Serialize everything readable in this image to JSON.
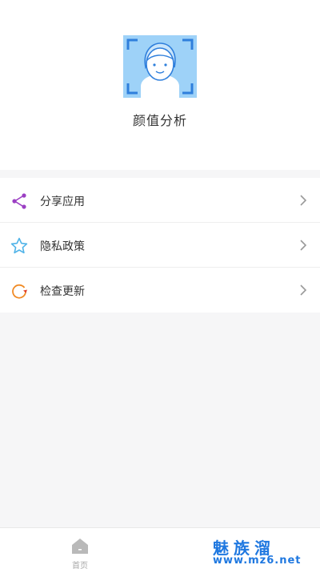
{
  "app": {
    "name": "颜值分析"
  },
  "menu": {
    "items": [
      {
        "label": "分享应用",
        "icon": "share-icon",
        "color": "#9b3fc3"
      },
      {
        "label": "隐私政策",
        "icon": "star-icon",
        "color": "#4fb3e8"
      },
      {
        "label": "检查更新",
        "icon": "refresh-icon",
        "color": "#f08a24"
      }
    ]
  },
  "tabbar": {
    "home_label": "首页"
  },
  "watermark": {
    "title": "魅族溜",
    "url": "www.mz6.net"
  },
  "colors": {
    "accent": "#1f78e0",
    "logo_bg": "#9ed2f8",
    "page_bg": "#f6f6f7"
  }
}
